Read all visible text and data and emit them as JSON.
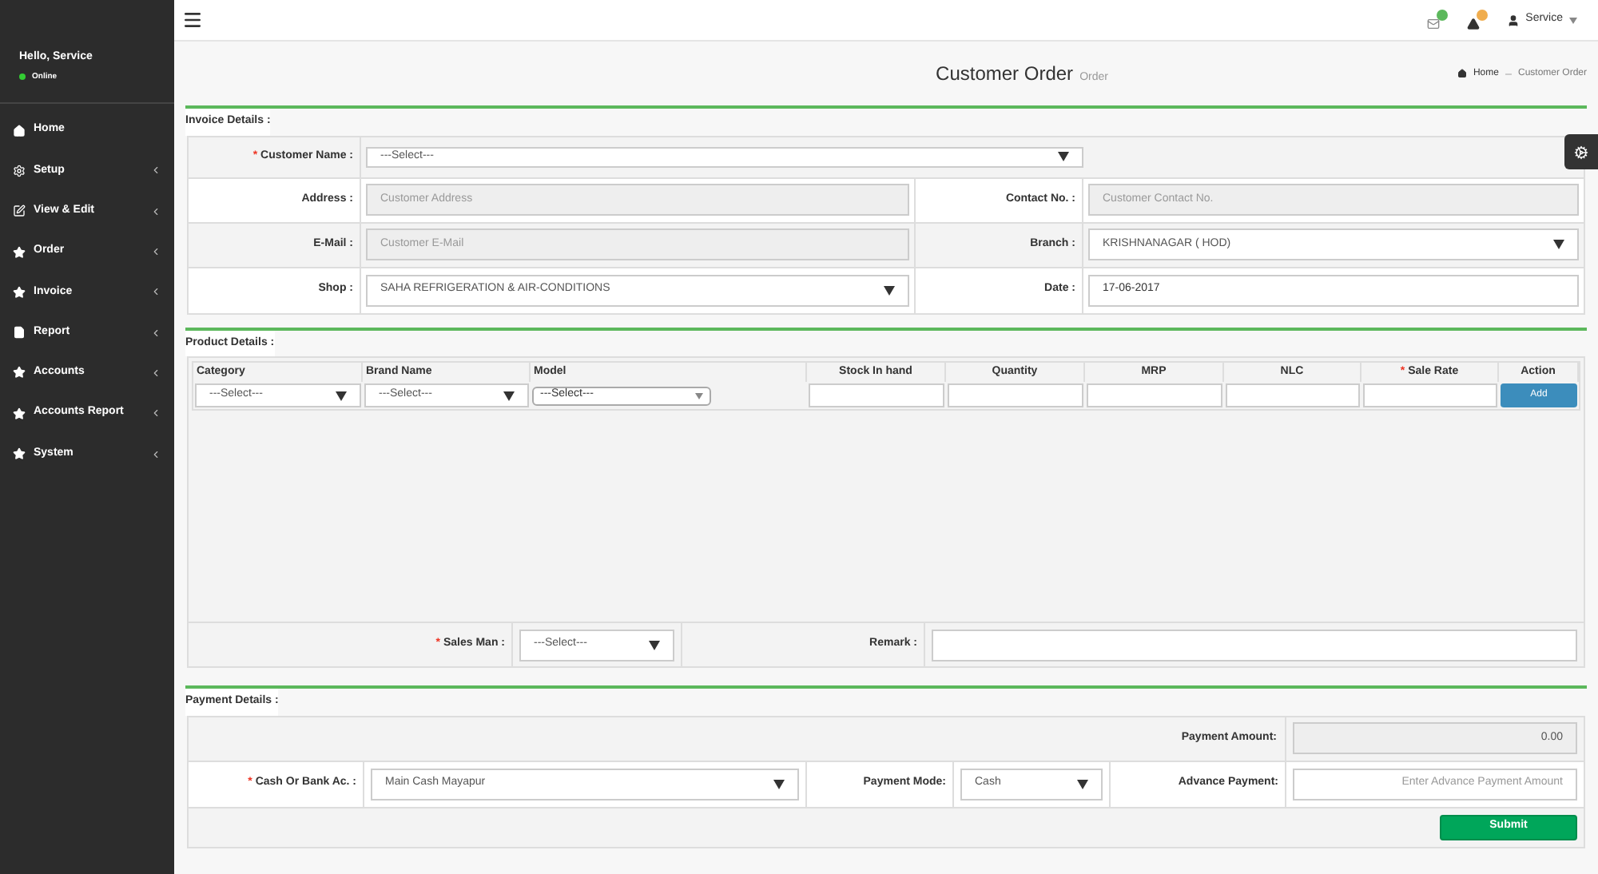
{
  "sidebar": {
    "greeting": "Hello, Service",
    "status": "Online",
    "online": true,
    "items": [
      {
        "label": "Home",
        "kind": "home",
        "submenu": false
      },
      {
        "label": "Setup",
        "kind": "gears",
        "submenu": true
      },
      {
        "label": "View & Edit",
        "kind": "edit",
        "submenu": true
      },
      {
        "label": "Order",
        "kind": "star",
        "submenu": true
      },
      {
        "label": "Invoice",
        "kind": "star",
        "submenu": true
      },
      {
        "label": "Report",
        "kind": "file",
        "submenu": true
      },
      {
        "label": "Accounts",
        "kind": "star",
        "submenu": true
      },
      {
        "label": "Accounts Report",
        "kind": "star",
        "submenu": true
      },
      {
        "label": "System",
        "kind": "star",
        "submenu": true
      }
    ]
  },
  "topbar": {
    "user": "Service"
  },
  "page": {
    "title": "Customer Order",
    "subtitle": "Order",
    "breadcrumb": [
      "Home",
      "Customer Order"
    ]
  },
  "invoice": {
    "heading": "Invoice Details :",
    "customer": {
      "label": "Customer Name :",
      "mark": "*",
      "kind": "select",
      "value": "---Select---"
    },
    "rows": [
      [
        {
          "label": "Address :",
          "kind": "readonly",
          "placeholder": "Customer Address"
        },
        {
          "label": "Contact No. :",
          "kind": "readonly",
          "placeholder": "Customer Contact No."
        }
      ],
      [
        {
          "label": "E-Mail :",
          "kind": "readonly",
          "placeholder": "Customer E-Mail"
        },
        {
          "label": "Branch :",
          "kind": "select",
          "value": "KRISHNANAGAR ( HOD)"
        }
      ],
      [
        {
          "label": "Shop :",
          "kind": "select",
          "value": "SAHA REFRIGERATION & AIR-CONDITIONS"
        },
        {
          "label": "Date :",
          "kind": "input",
          "value": "17-06-2017"
        }
      ]
    ]
  },
  "product": {
    "heading": "Product Details :",
    "columns": [
      {
        "label": "Category"
      },
      {
        "label": "Brand Name"
      },
      {
        "label": "Model"
      },
      {
        "label": "Stock In hand"
      },
      {
        "label": "Quantity"
      },
      {
        "label": "MRP"
      },
      {
        "label": "NLC"
      },
      {
        "label": "Sale Rate",
        "mark": "*"
      },
      {
        "label": "Action"
      }
    ],
    "entry": [
      {
        "kind": "select",
        "value": "---Select---"
      },
      {
        "kind": "select",
        "value": "---Select---"
      },
      {
        "kind": "smallselect",
        "value": "---Select---"
      },
      {
        "kind": "input"
      },
      {
        "kind": "input"
      },
      {
        "kind": "input"
      },
      {
        "kind": "input"
      },
      {
        "kind": "input"
      },
      {
        "kind": "button",
        "label": "Add"
      }
    ],
    "sales_man": {
      "label": "Sales Man :",
      "mark": "*",
      "kind": "select",
      "value": "---Select---"
    },
    "remark": {
      "label": "Remark :",
      "kind": "input"
    }
  },
  "payment": {
    "heading": "Payment Details :",
    "amount": {
      "label": "Payment Amount:",
      "value": "0.00"
    },
    "fields": [
      {
        "label": "Cash Or Bank Ac. :",
        "mark": "*",
        "kind": "select",
        "value": "Main Cash Mayapur"
      },
      {
        "label": "Payment Mode:",
        "kind": "select",
        "value": "Cash"
      },
      {
        "label": "Advance Payment:",
        "kind": "input",
        "placeholder": "Enter Advance Payment Amount"
      }
    ],
    "submit": "Submit"
  }
}
